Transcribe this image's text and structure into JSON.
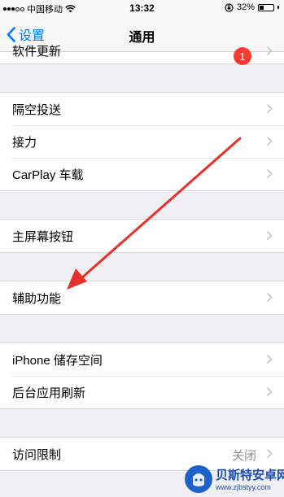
{
  "status_bar": {
    "carrier": "中国移动",
    "time": "13:32",
    "battery_percent": "32%",
    "battery_level": 0.32,
    "icons": [
      "signal-icon",
      "wifi-icon",
      "rotation-lock-icon",
      "battery-icon"
    ]
  },
  "nav": {
    "back_label": "设置",
    "title": "通用"
  },
  "partial_row": {
    "label": "软件更新",
    "badge": "1"
  },
  "group1": [
    {
      "label": "隔空投送"
    },
    {
      "label": "接力"
    },
    {
      "label": "CarPlay 车载"
    }
  ],
  "group2": [
    {
      "label": "主屏幕按钮"
    }
  ],
  "group3": [
    {
      "label": "辅助功能"
    }
  ],
  "group4": [
    {
      "label": "iPhone 储存空间"
    },
    {
      "label": "后台应用刷新"
    }
  ],
  "group5": [
    {
      "label": "访问限制",
      "detail": "关闭"
    }
  ],
  "watermark": {
    "title": "贝斯特安卓网",
    "url": "www.zjbstyy.com"
  },
  "colors": {
    "accent": "#007aff",
    "badge": "#ff3b30",
    "annotation_arrow": "#e8302b",
    "background": "#efeff4"
  }
}
